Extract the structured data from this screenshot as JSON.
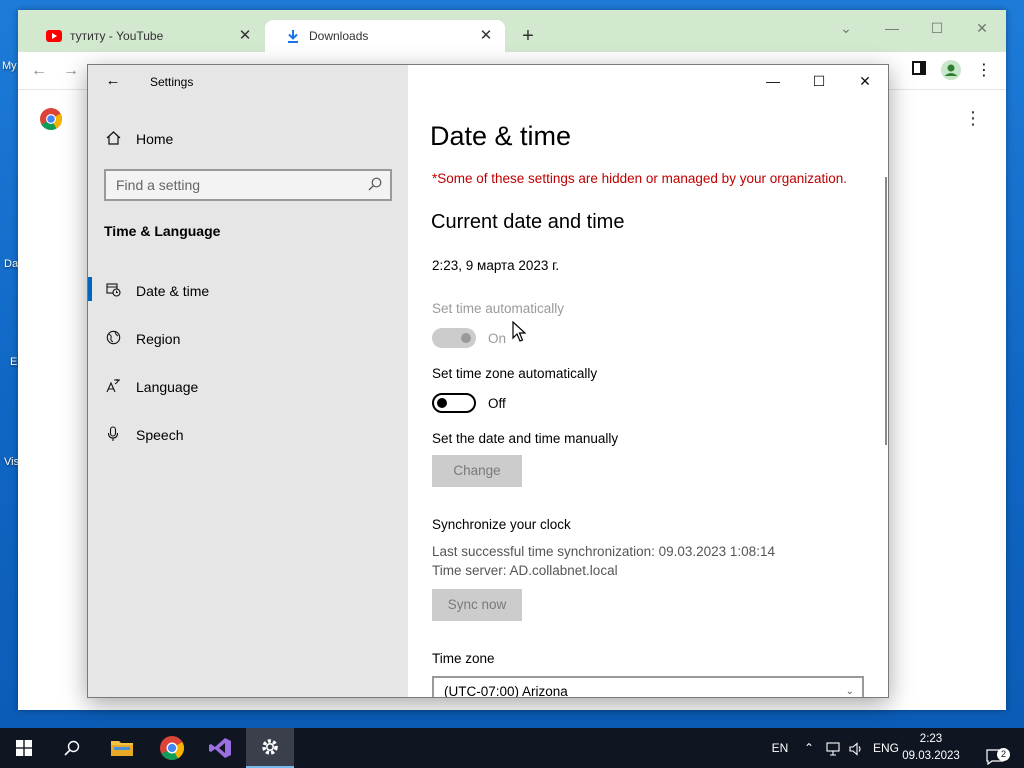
{
  "desktop": {
    "labels": [
      "My",
      "Da",
      "E",
      "Vis"
    ]
  },
  "chrome": {
    "tabs": [
      {
        "label": "тутиту - YouTube",
        "icon": "youtube-icon"
      },
      {
        "label": "Downloads",
        "icon": "download-icon"
      }
    ],
    "new_tab": "+",
    "window_controls": {
      "minimize": "—",
      "maximize": "☐",
      "close": "✕"
    },
    "toolbar": {
      "back": "←",
      "forward": "→",
      "menu": "⋮"
    }
  },
  "settings": {
    "title": "Settings",
    "back": "←",
    "window_controls": {
      "minimize": "—",
      "maximize": "☐",
      "close": "✕"
    },
    "nav": {
      "home": "Home",
      "search_placeholder": "Find a setting",
      "section": "Time & Language",
      "items": [
        {
          "label": "Date & time",
          "icon": "clock-calendar-icon",
          "selected": true
        },
        {
          "label": "Region",
          "icon": "globe-icon"
        },
        {
          "label": "Language",
          "icon": "language-icon"
        },
        {
          "label": "Speech",
          "icon": "microphone-icon"
        }
      ]
    },
    "content": {
      "page_title": "Date & time",
      "org_note": "*Some of these settings are hidden or managed by your organization.",
      "current_heading": "Current date and time",
      "current_value": "2:23, 9 марта 2023 г.",
      "auto_time": {
        "label": "Set time automatically",
        "state": "On",
        "enabled": false
      },
      "auto_zone": {
        "label": "Set time zone automatically",
        "state": "Off",
        "enabled": true
      },
      "manual": {
        "label": "Set the date and time manually",
        "button": "Change"
      },
      "sync": {
        "heading": "Synchronize your clock",
        "last_sync": "Last successful time synchronization: 09.03.2023 1:08:14",
        "server": "Time server: AD.collabnet.local",
        "button": "Sync now"
      },
      "time_zone": {
        "label": "Time zone",
        "value": "(UTC-07:00) Arizona"
      }
    }
  },
  "taskbar": {
    "apps": [
      "start-icon",
      "search-icon",
      "file-explorer-icon",
      "chrome-icon",
      "visual-studio-icon",
      "settings-icon"
    ],
    "tray": {
      "lang_en": "EN",
      "lang_eng": "ENG",
      "time": "2:23",
      "date": "09.03.2023",
      "notifications": "2"
    }
  }
}
